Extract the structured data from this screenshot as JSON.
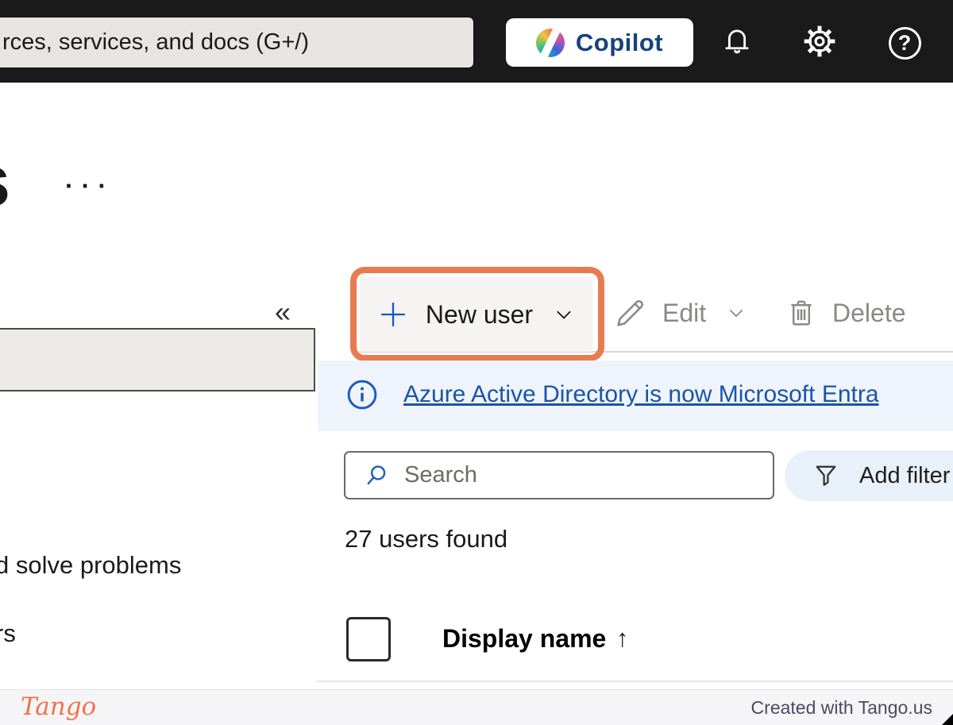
{
  "topbar": {
    "search_value": "rces, services, and docs (G+/)",
    "copilot_label": "Copilot",
    "help_glyph": "?"
  },
  "page": {
    "heading_partial": "s",
    "more_menu_glyph": "···",
    "collapse_glyph": "«",
    "partial_text_1": "d solve problems",
    "partial_text_2": "rs"
  },
  "toolbar": {
    "new_user": "New user",
    "edit": "Edit",
    "delete": "Delete"
  },
  "banner": {
    "link_text": "Azure Active Directory is now Microsoft Entra"
  },
  "filter_row": {
    "search_placeholder": "Search",
    "add_filter": "Add filter"
  },
  "results": {
    "count": "27 users found"
  },
  "table": {
    "display_name_header": "Display name",
    "sort_ascending_glyph": "↑"
  },
  "footer": {
    "brand": "Tango",
    "credit": "Created with Tango.us"
  },
  "colors": {
    "highlight_orange": "#E87C50",
    "topbar_bg": "#1A1A1A",
    "copilot_text": "#17427B",
    "banner_bg": "#EFF4FC",
    "link_blue": "#1A54A8",
    "accent_blue": "#1B5EBD",
    "disabled_gray": "#8B8987",
    "filter_pill_bg": "#E8F1FA",
    "button_bg": "#F5F4F2",
    "tango_orange": "#F0734A",
    "credit_gray": "#4B4A60"
  }
}
